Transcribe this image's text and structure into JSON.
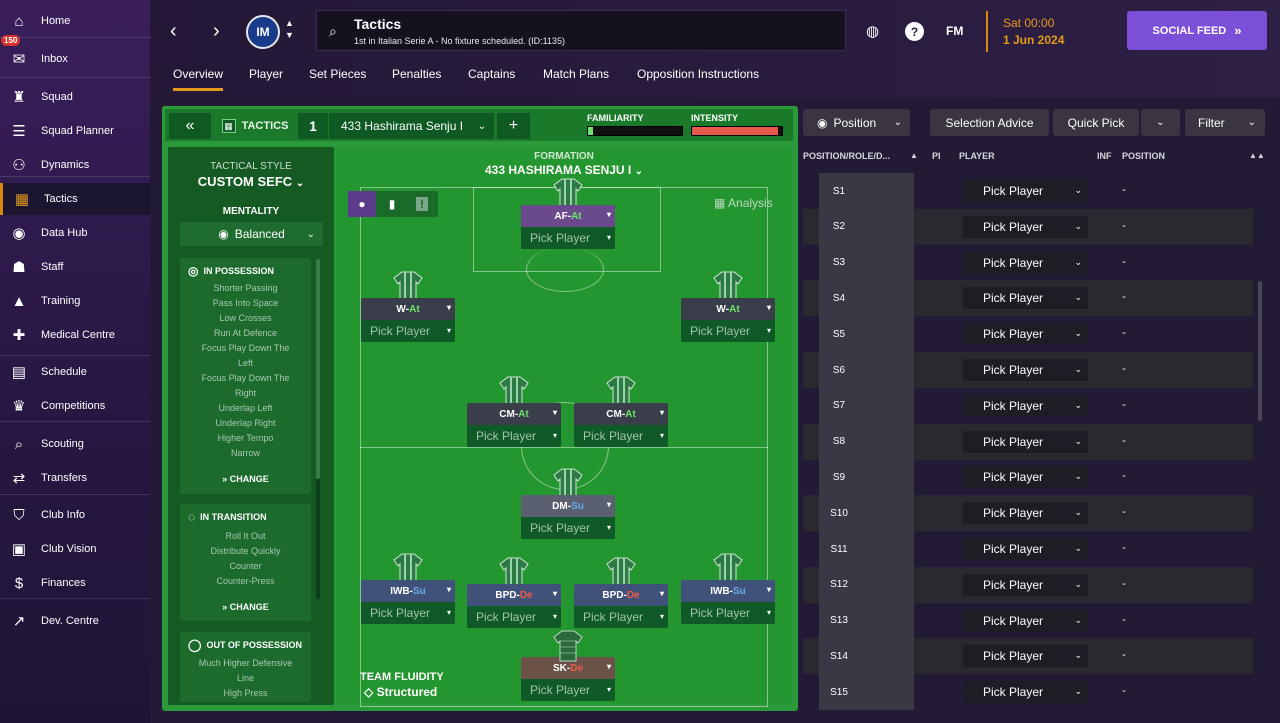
{
  "sidebar": {
    "items": [
      {
        "label": "Home",
        "icon": "home-icon",
        "glyph": "⌂"
      },
      {
        "label": "Inbox",
        "icon": "mail-icon",
        "glyph": "✉",
        "badge": "150"
      },
      {
        "label": "Squad",
        "icon": "shirt-icon",
        "glyph": "♜"
      },
      {
        "label": "Squad Planner",
        "icon": "clipboard-icon",
        "glyph": "☰"
      },
      {
        "label": "Dynamics",
        "icon": "people-icon",
        "glyph": "⚇"
      },
      {
        "label": "Tactics",
        "icon": "tactics-board-icon",
        "glyph": "▦",
        "active": true
      },
      {
        "label": "Data Hub",
        "icon": "data-icon",
        "glyph": "◉"
      },
      {
        "label": "Staff",
        "icon": "staff-icon",
        "glyph": "☗"
      },
      {
        "label": "Training",
        "icon": "cone-icon",
        "glyph": "▲"
      },
      {
        "label": "Medical Centre",
        "icon": "medical-icon",
        "glyph": "✚"
      },
      {
        "label": "Schedule",
        "icon": "calendar-icon",
        "glyph": "▤"
      },
      {
        "label": "Competitions",
        "icon": "trophy-icon",
        "glyph": "♛"
      },
      {
        "label": "Scouting",
        "icon": "search-icon",
        "glyph": "⌕"
      },
      {
        "label": "Transfers",
        "icon": "transfer-icon",
        "glyph": "⇄"
      },
      {
        "label": "Club Info",
        "icon": "shield-icon",
        "glyph": "⛉"
      },
      {
        "label": "Club Vision",
        "icon": "briefcase-icon",
        "glyph": "▣"
      },
      {
        "label": "Finances",
        "icon": "money-icon",
        "glyph": "$"
      },
      {
        "label": "Dev. Centre",
        "icon": "trend-icon",
        "glyph": "↗"
      }
    ]
  },
  "header": {
    "title": "Tactics",
    "subtitle": "1st in Italian Serie A - No fixture scheduled. (ID:1135)",
    "club_abbr": "IM",
    "date_line1": "Sat 00:00",
    "date_line2": "1 Jun 2024",
    "fm_label": "FM",
    "social_label": "SOCIAL FEED"
  },
  "tabs": [
    "Overview",
    "Player",
    "Set Pieces",
    "Penalties",
    "Captains",
    "Match Plans",
    "Opposition Instructions"
  ],
  "tactic_bar": {
    "tactics_label": "TACTICS",
    "slot": "1",
    "tactic_name": "433 Hashirama Senju I",
    "familiarity_label": "FAMILIARITY",
    "intensity_label": "INTENSITY",
    "familiarity_level": 0.05,
    "intensity_level": 0.95
  },
  "left_panel": {
    "tactical_style_label": "TACTICAL STYLE",
    "tactical_style": "CUSTOM SEFC",
    "mentality_label": "MENTALITY",
    "mentality": "Balanced",
    "in_possession": {
      "title": "IN POSSESSION",
      "lines": [
        "Shorter Passing",
        "Pass Into Space",
        "Low Crosses",
        "Run At Defence",
        "Focus Play Down The",
        "Left",
        "Focus Play Down The",
        "Right",
        "Underlap Left",
        "Underlap Right",
        "Higher Tempo",
        "Narrow"
      ],
      "change": "CHANGE"
    },
    "in_transition": {
      "title": "IN TRANSITION",
      "lines": [
        "Roll It Out",
        "Distribute Quickly",
        "Counter",
        "Counter-Press"
      ],
      "change": "CHANGE"
    },
    "out_of_possession": {
      "title": "OUT OF POSSESSION",
      "lines": [
        "Much Higher Defensive",
        "Line",
        "High Press"
      ]
    }
  },
  "field": {
    "formation_label": "FORMATION",
    "formation_name": "433 HASHIRAMA SENJU I",
    "analysis_label": "Analysis",
    "team_fluidity_label": "TEAM FLUIDITY",
    "team_fluidity": "Structured",
    "positions": [
      {
        "role": "AF",
        "duty": "At",
        "player": "Pick Player"
      },
      {
        "role": "W",
        "duty": "At",
        "player": "Pick Player"
      },
      {
        "role": "W",
        "duty": "At",
        "player": "Pick Player"
      },
      {
        "role": "CM",
        "duty": "At",
        "player": "Pick Player"
      },
      {
        "role": "CM",
        "duty": "At",
        "player": "Pick Player"
      },
      {
        "role": "DM",
        "duty": "Su",
        "player": "Pick Player"
      },
      {
        "role": "IWB",
        "duty": "Su",
        "player": "Pick Player"
      },
      {
        "role": "BPD",
        "duty": "De",
        "player": "Pick Player"
      },
      {
        "role": "BPD",
        "duty": "De",
        "player": "Pick Player"
      },
      {
        "role": "IWB",
        "duty": "Su",
        "player": "Pick Player"
      },
      {
        "role": "SK",
        "duty": "De",
        "player": "Pick Player"
      }
    ]
  },
  "right_panel": {
    "position_btn": "Position",
    "selection_advice": "Selection Advice",
    "quick_pick": "Quick Pick",
    "filter": "Filter",
    "columns": {
      "position_role": "POSITION/ROLE/D...",
      "pi": "PI",
      "player": "PLAYER",
      "inf": "INF",
      "position": "POSITION"
    },
    "rows": [
      {
        "slot": "S1",
        "player": "Pick Player",
        "position": "-"
      },
      {
        "slot": "S2",
        "player": "Pick Player",
        "position": "-"
      },
      {
        "slot": "S3",
        "player": "Pick Player",
        "position": "-"
      },
      {
        "slot": "S4",
        "player": "Pick Player",
        "position": "-"
      },
      {
        "slot": "S5",
        "player": "Pick Player",
        "position": "-"
      },
      {
        "slot": "S6",
        "player": "Pick Player",
        "position": "-"
      },
      {
        "slot": "S7",
        "player": "Pick Player",
        "position": "-"
      },
      {
        "slot": "S8",
        "player": "Pick Player",
        "position": "-"
      },
      {
        "slot": "S9",
        "player": "Pick Player",
        "position": "-"
      },
      {
        "slot": "S10",
        "player": "Pick Player",
        "position": "-"
      },
      {
        "slot": "S11",
        "player": "Pick Player",
        "position": "-"
      },
      {
        "slot": "S12",
        "player": "Pick Player",
        "position": "-"
      },
      {
        "slot": "S13",
        "player": "Pick Player",
        "position": "-"
      },
      {
        "slot": "S14",
        "player": "Pick Player",
        "position": "-"
      },
      {
        "slot": "S15",
        "player": "Pick Player",
        "position": "-"
      }
    ]
  },
  "colors": {
    "accent": "#e59a1a",
    "social": "#7b4fd8",
    "pitch": "#2a9a3a",
    "attack": "#6ee36b",
    "support": "#66a9ef",
    "defend": "#ef5a4a"
  }
}
